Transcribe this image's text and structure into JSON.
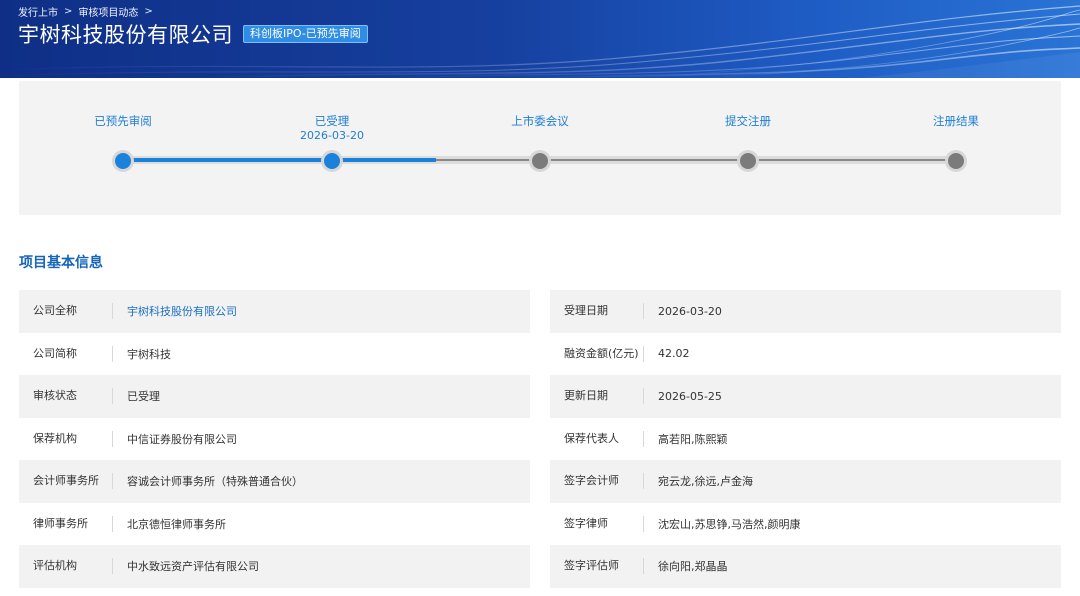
{
  "breadcrumb": [
    "发行上市",
    "审核项目动态"
  ],
  "company": {
    "title": "宇树科技股份有限公司",
    "badge": "科创板IPO-已预先审阅"
  },
  "progress": {
    "steps": [
      {
        "label": "已预先审阅",
        "date": "",
        "state": "done"
      },
      {
        "label": "已受理",
        "date": "2026-03-20",
        "state": "current"
      },
      {
        "label": "上市委会议",
        "date": "",
        "state": "pending"
      },
      {
        "label": "提交注册",
        "date": "",
        "state": "pending"
      },
      {
        "label": "注册结果",
        "date": "",
        "state": "pending"
      }
    ],
    "completed_fraction": 0.375
  },
  "section_title": "项目基本信息",
  "info_left": [
    {
      "key": "公司全称",
      "value": "宇树科技股份有限公司",
      "link": true
    },
    {
      "key": "公司简称",
      "value": "宇树科技"
    },
    {
      "key": "审核状态",
      "value": "已受理"
    },
    {
      "key": "保荐机构",
      "value": "中信证券股份有限公司"
    },
    {
      "key": "会计师事务所",
      "value": "容诚会计师事务所（特殊普通合伙）"
    },
    {
      "key": "律师事务所",
      "value": "北京德恒律师事务所"
    },
    {
      "key": "评估机构",
      "value": "中水致远资产评估有限公司"
    }
  ],
  "info_right": [
    {
      "key": "受理日期",
      "value": "2026-03-20"
    },
    {
      "key": "融资金额(亿元)",
      "value": "42.02"
    },
    {
      "key": "更新日期",
      "value": "2026-05-25"
    },
    {
      "key": "保荐代表人",
      "value": "高若阳,陈熙颖"
    },
    {
      "key": "签字会计师",
      "value": "宛云龙,徐远,卢金海"
    },
    {
      "key": "签字律师",
      "value": "沈宏山,苏思铮,马浩然,颜明康"
    },
    {
      "key": "签字评估师",
      "value": "徐向阳,郑晶晶"
    }
  ],
  "colors": {
    "accent": "#1a82db",
    "node_done": "#1a82db",
    "node_pending": "#7b7b7b",
    "banner_dark": "#0f2f86"
  }
}
